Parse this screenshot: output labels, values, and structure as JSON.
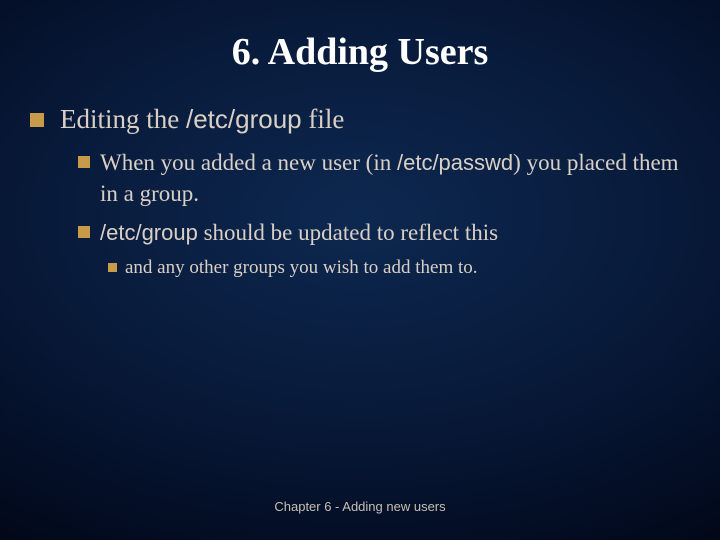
{
  "title": "6. Adding Users",
  "lvl1": {
    "prefix": "Editing the ",
    "mono": "/etc/group",
    "suffix": " file"
  },
  "lvl2a": {
    "prefix": "When you added a new user (in ",
    "mono": "/etc/passwd",
    "suffix": ") you placed them in a group."
  },
  "lvl2b": {
    "mono": "/etc/group",
    "suffix": " should be updated to reflect this"
  },
  "lvl3": "and any other groups you wish to add them to.",
  "footer": "Chapter 6 - Adding new users"
}
